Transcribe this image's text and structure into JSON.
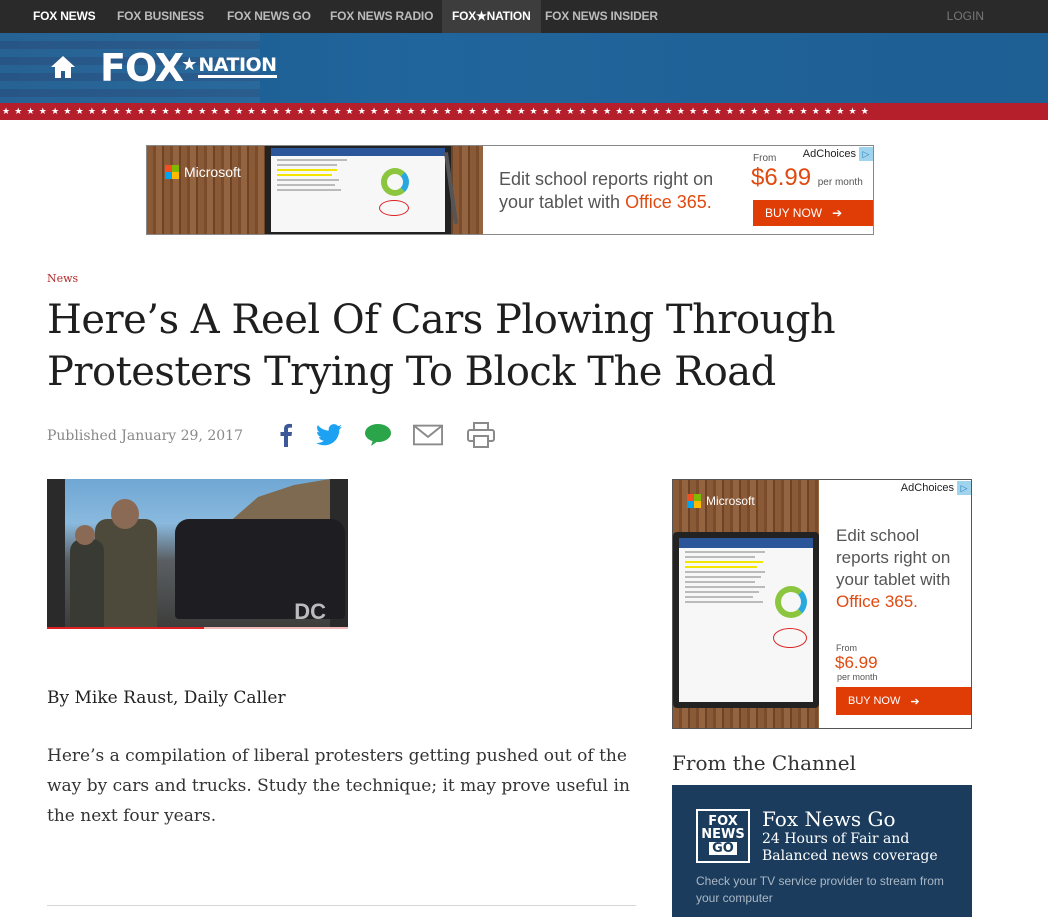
{
  "topnav": {
    "items": [
      {
        "label": "FOX NEWS"
      },
      {
        "label": "FOX BUSINESS"
      },
      {
        "label": "FOX NEWS GO"
      },
      {
        "label": "FOX NEWS RADIO"
      },
      {
        "label": "FOX★NATION",
        "active": true
      },
      {
        "label": "FOX NEWS INSIDER"
      }
    ],
    "login": "LOGIN"
  },
  "header": {
    "logo_fox": "FOX",
    "logo_star": "★",
    "logo_nation": "NATION",
    "stars": "★★★★★★★★★★★★★★★★★★★★★★★★★★★★★★★★★★★★★★★★★★★★★★★★★★★★★★★★★★★★★★★★★★★★★★★"
  },
  "top_ad": {
    "brand": "Microsoft",
    "text_line1": "Edit school reports right on",
    "text_line2_prefix": "your tablet with ",
    "text_line2_accent": "Office 365.",
    "from": "From",
    "price": "$6.99",
    "per_month": "per month",
    "buy_label": "BUY NOW",
    "adchoices": "AdChoices"
  },
  "article": {
    "category": "News",
    "headline_line1": "Here’s A Reel Of Cars Plowing Through",
    "headline_line2": "Protesters Trying To Block The Road",
    "published": "Published January 29, 2017",
    "video_watermark": "DC",
    "video_progress": 0.52,
    "byline": "By Mike Raust, Daily Caller",
    "body": "Here’s a compilation of liberal protesters getting pushed out of the way by cars and trucks. Study the technique; it may prove useful in the next four years."
  },
  "side_ad": {
    "brand": "Microsoft",
    "adchoices": "AdChoices",
    "text_line1": "Edit school",
    "text_line2": "reports right on",
    "text_line3": "your tablet with",
    "text_accent": "Office 365.",
    "from": "From",
    "price": "$6.99",
    "per_month": "per month",
    "buy_label": "BUY NOW"
  },
  "channel": {
    "heading": "From the Channel",
    "logo_line1": "FOX",
    "logo_line2": "NEWS",
    "logo_line3": "GO",
    "title": "Fox News Go",
    "subtitle": "24 Hours of Fair and Balanced news coverage",
    "note": "Check your TV service provider to stream from your computer"
  },
  "colors": {
    "brand_red": "#b51f2b",
    "header_blue": "#1e5f94",
    "office_orange": "#e04a10",
    "facebook": "#3b5998",
    "twitter": "#1da1f2",
    "comment": "#2aa54a"
  },
  "icons": [
    "home-icon",
    "facebook-icon",
    "twitter-icon",
    "comment-icon",
    "email-icon",
    "print-icon"
  ]
}
